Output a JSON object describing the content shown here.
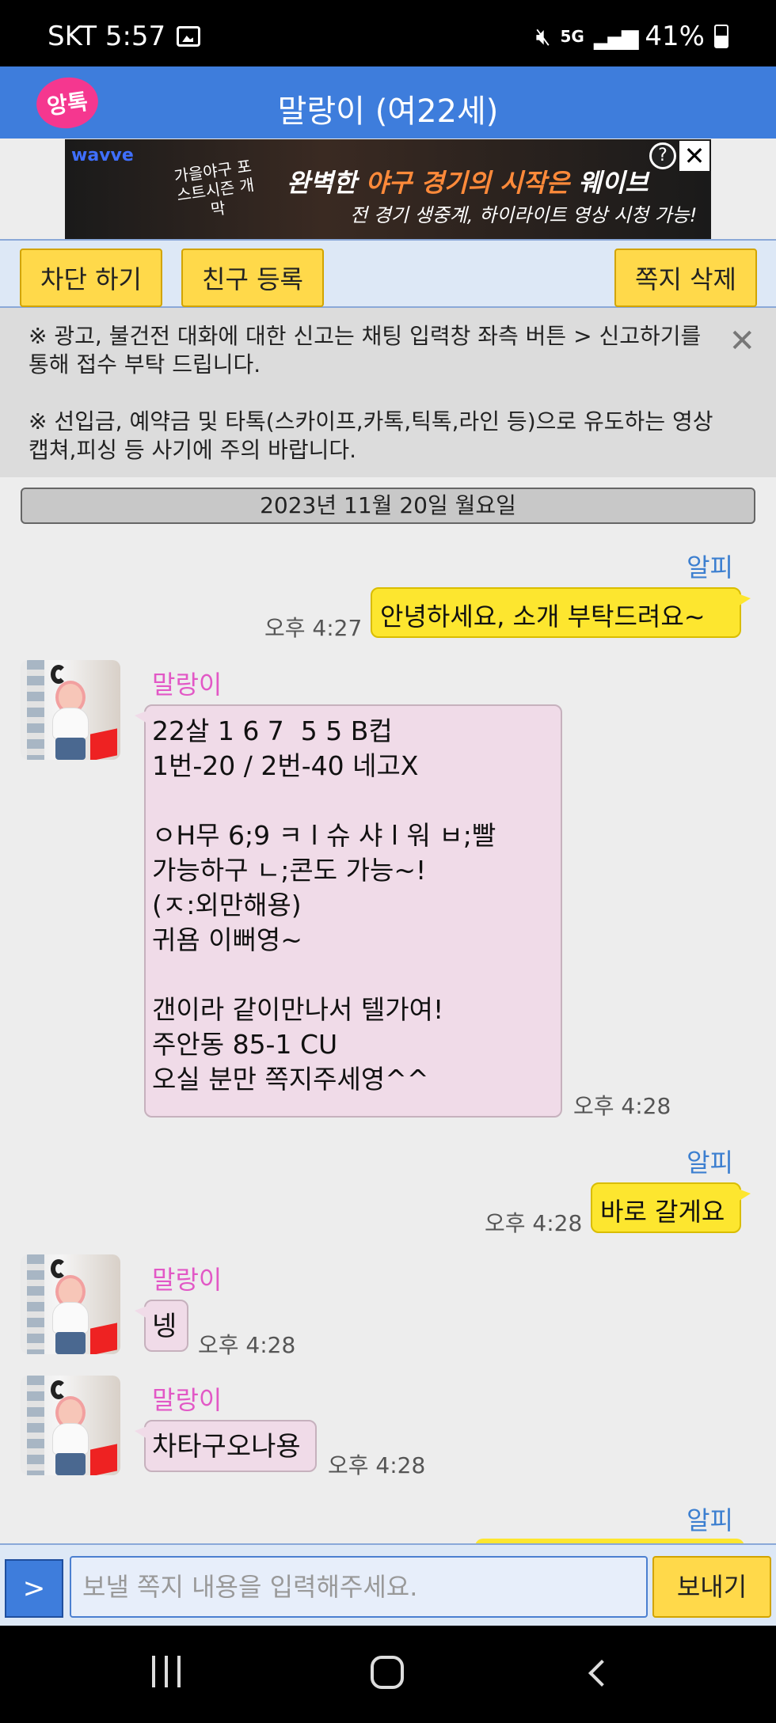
{
  "status_bar": {
    "carrier_time": "SKT 5:57",
    "network": "5G",
    "battery": "41%"
  },
  "header": {
    "logo": "앙톡",
    "title": "말랑이 (여22세)"
  },
  "ad": {
    "brand": "wavve",
    "sub": "가을야구 포스트시즌 개막",
    "headline_a": "완벽한 ",
    "headline_b": "야구 경기의 시작은",
    "headline_c": " 웨이브",
    "line2": "전 경기 생중계, 하이라이트 영상 시청 가능!",
    "help": "?",
    "close": "✕"
  },
  "toolbar": {
    "block": "차단 하기",
    "add_friend": "친구 등록",
    "delete": "쪽지 삭제"
  },
  "notice": {
    "p1": "※ 광고, 불건전 대화에 대한 신고는 채팅 입력창 좌측 버튼 > 신고하기를 통해 접수 부탁 드립니다.",
    "p2": "※ 선입금, 예약금 및 타톡(스카이프,카톡,틱톡,라인 등)으로 유도하는 영상캡쳐,피싱 등 사기에 주의 바랍니다.",
    "close": "✕"
  },
  "date_separator": "2023년 11월 20일 월요일",
  "messages": [
    {
      "sender": "알피",
      "text": "안녕하세요, 소개 부탁드려요~",
      "time": "오후 4:27"
    },
    {
      "sender": "말랑이",
      "text": "22살 1 6 7  5 5 B컵\n1번-20 / 2번-40 네고X\n\nㅇH무 6;9 ㅋ l 슈 샤 l 워 ㅂ;빨\n가능하구 ㄴ;콘도 가능~!\n(ㅈ:외만해용)\n귀욤 이뻐영~\n\n갠이라 같이만나서 텔가여!\n주안동 85-1 CU\n오실 분만 쪽지주세영^^",
      "time": "오후 4:28"
    },
    {
      "sender": "알피",
      "text": "바로 갈게요",
      "time": "오후 4:28"
    },
    {
      "sender": "말랑이",
      "text": "넹",
      "time": "오후 4:28"
    },
    {
      "sender": "말랑이",
      "text": "차타구오나용",
      "time": "오후 4:28"
    },
    {
      "sender": "알피"
    }
  ],
  "input": {
    "menu_button": ">",
    "placeholder": "보낼 쪽지 내용을 입력해주세요.",
    "send": "보내기"
  }
}
